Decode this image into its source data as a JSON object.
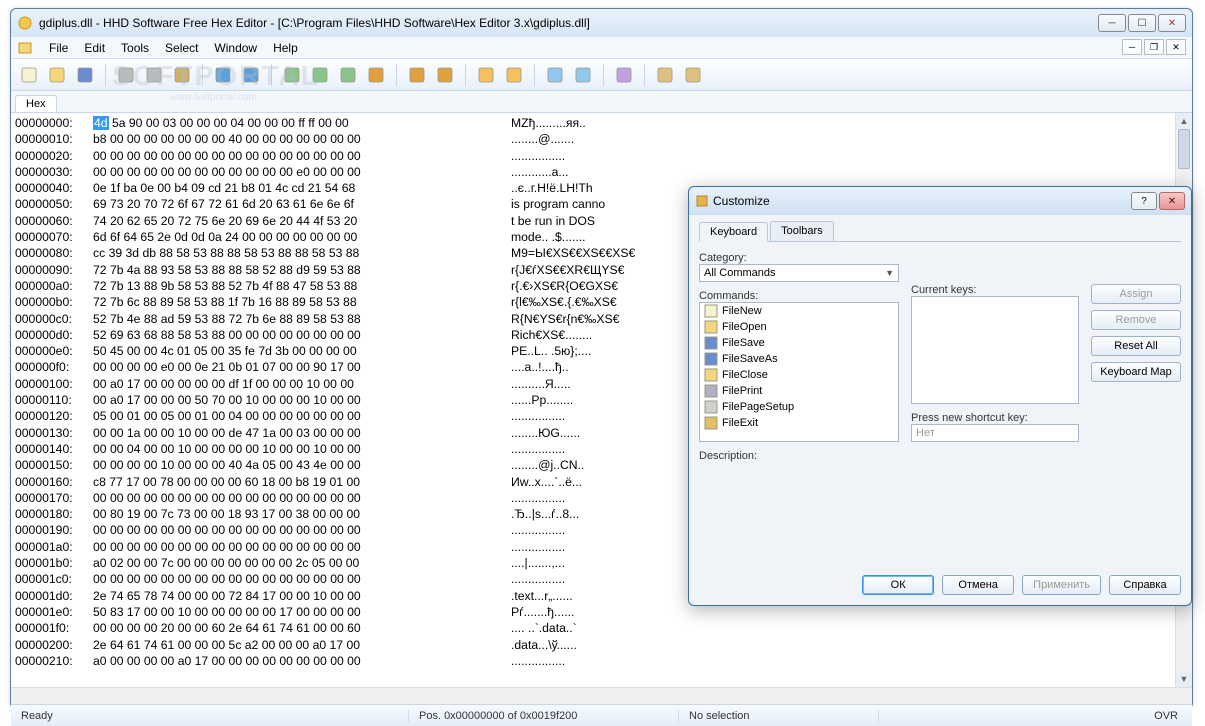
{
  "window": {
    "title": "gdiplus.dll - HHD Software Free Hex Editor - [C:\\Program Files\\HHD Software\\Hex Editor 3.x\\gdiplus.dll]"
  },
  "menus": [
    "File",
    "Edit",
    "Tools",
    "Select",
    "Window",
    "Help"
  ],
  "tab": {
    "label": "Hex"
  },
  "watermark": {
    "main": "SOFTPORTAL",
    "sub": "www.softportal.com"
  },
  "status": {
    "ready": "Ready",
    "pos": "Pos. 0x00000000 of 0x0019f200",
    "sel": "No selection",
    "mode": "OVR"
  },
  "hex_rows": [
    {
      "offset": "00000000:",
      "first": "4d",
      "bytes": " 5a 90 00 03 00 00 00 04 00 00 00 ff ff 00 00",
      "ascii": "MZђ.........яя.."
    },
    {
      "offset": "00000010:",
      "bytes": "b8 00 00 00 00 00 00 00 40 00 00 00 00 00 00 00",
      "ascii": "........@......."
    },
    {
      "offset": "00000020:",
      "bytes": "00 00 00 00 00 00 00 00 00 00 00 00 00 00 00 00",
      "ascii": "................"
    },
    {
      "offset": "00000030:",
      "bytes": "00 00 00 00 00 00 00 00 00 00 00 00 e0 00 00 00",
      "ascii": "............a..."
    },
    {
      "offset": "00000040:",
      "bytes": "0e 1f ba 0e 00 b4 09 cd 21 b8 01 4c cd 21 54 68",
      "ascii": "..є..г.Н!ё.LH!Th"
    },
    {
      "offset": "00000050:",
      "bytes": "69 73 20 70 72 6f 67 72 61 6d 20 63 61 6e 6e 6f",
      "ascii": "is program canno"
    },
    {
      "offset": "00000060:",
      "bytes": "74 20 62 65 20 72 75 6e 20 69 6e 20 44 4f 53 20",
      "ascii": "t be run in DOS "
    },
    {
      "offset": "00000070:",
      "bytes": "6d 6f 64 65 2e 0d 0d 0a 24 00 00 00 00 00 00 00",
      "ascii": "mode.. .$......."
    },
    {
      "offset": "00000080:",
      "bytes": "cc 39 3d db 88 58 53 88 88 58 53 88 88 58 53 88",
      "ascii": "M9=Ы€XS€€XS€€XS€"
    },
    {
      "offset": "00000090:",
      "bytes": "72 7b 4a 88 93 58 53 88 88 58 52 88 d9 59 53 88",
      "ascii": "r{J€ѓXS€€XR€ЩYS€"
    },
    {
      "offset": "000000a0:",
      "bytes": "72 7b 13 88 9b 58 53 88 52 7b 4f 88 47 58 53 88",
      "ascii": "r{.€›XS€R{O€GXS€"
    },
    {
      "offset": "000000b0:",
      "bytes": "72 7b 6c 88 89 58 53 88 1f 7b 16 88 89 58 53 88",
      "ascii": "r{l€‰XS€.{.€‰XS€"
    },
    {
      "offset": "000000c0:",
      "bytes": "52 7b 4e 88 ad 59 53 88 72 7b 6e 88 89 58 53 88",
      "ascii": "R{N€­YS€r{n€‰XS€"
    },
    {
      "offset": "000000d0:",
      "bytes": "52 69 63 68 88 58 53 88 00 00 00 00 00 00 00 00",
      "ascii": "Rich€XS€........"
    },
    {
      "offset": "000000e0:",
      "bytes": "50 45 00 00 4c 01 05 00 35 fe 7d 3b 00 00 00 00",
      "ascii": "PE..L.. .5ю};...."
    },
    {
      "offset": "000000f0:",
      "bytes": "00 00 00 00 e0 00 0e 21 0b 01 07 00 00 90 17 00",
      "ascii": "....a..!....ђ.."
    },
    {
      "offset": "00000100:",
      "bytes": "00 a0 17 00 00 00 00 00 df 1f 00 00 00 10 00 00",
      "ascii": "..........Я....."
    },
    {
      "offset": "00000110:",
      "bytes": "00 a0 17 00 00 00 50 70 00 10 00 00 00 10 00 00",
      "ascii": "......Pp........"
    },
    {
      "offset": "00000120:",
      "bytes": "05 00 01 00 05 00 01 00 04 00 00 00 00 00 00 00",
      "ascii": "................"
    },
    {
      "offset": "00000130:",
      "bytes": "00 00 1a 00 00 10 00 00 de 47 1a 00 03 00 00 00",
      "ascii": "........ЮG......"
    },
    {
      "offset": "00000140:",
      "bytes": "00 00 04 00 00 10 00 00 00 00 10 00 00 10 00 00",
      "ascii": "................"
    },
    {
      "offset": "00000150:",
      "bytes": "00 00 00 00 10 00 00 00 40 4a 05 00 43 4e 00 00",
      "ascii": "........@j..CN.."
    },
    {
      "offset": "00000160:",
      "bytes": "c8 77 17 00 78 00 00 00 00 60 18 00 b8 19 01 00",
      "ascii": "Иw..х....`..ё..."
    },
    {
      "offset": "00000170:",
      "bytes": "00 00 00 00 00 00 00 00 00 00 00 00 00 00 00 00",
      "ascii": "................"
    },
    {
      "offset": "00000180:",
      "bytes": "00 80 19 00 7c 73 00 00 18 93 17 00 38 00 00 00",
      "ascii": ".Ђ..|s...ѓ..8..."
    },
    {
      "offset": "00000190:",
      "bytes": "00 00 00 00 00 00 00 00 00 00 00 00 00 00 00 00",
      "ascii": "................"
    },
    {
      "offset": "000001a0:",
      "bytes": "00 00 00 00 00 00 00 00 00 00 00 00 00 00 00 00",
      "ascii": "................"
    },
    {
      "offset": "000001b0:",
      "bytes": "a0 02 00 00 7c 00 00 00 00 00 00 00 2c 05 00 00",
      "ascii": "....|.......,..."
    },
    {
      "offset": "000001c0:",
      "bytes": "00 00 00 00 00 00 00 00 00 00 00 00 00 00 00 00",
      "ascii": "................"
    },
    {
      "offset": "000001d0:",
      "bytes": "2e 74 65 78 74 00 00 00 72 84 17 00 00 10 00 00",
      "ascii": ".text...r„......"
    },
    {
      "offset": "000001e0:",
      "bytes": "50 83 17 00 00 10 00 00 00 00 00 17 00 00 00 00",
      "ascii": "Pѓ.......ђ......"
    },
    {
      "offset": "000001f0:",
      "bytes": "00 00 00 00 20 00 00 60 2e 64 61 74 61 00 00 60",
      "ascii": ".... ..`.data..`"
    },
    {
      "offset": "00000200:",
      "bytes": "2e 64 61 74 61 00 00 00 5c a2 00 00 00 a0 17 00",
      "ascii": ".data...\\ў......"
    },
    {
      "offset": "00000210:",
      "bytes": "a0 00 00 00 00 a0 17 00 00 00 00 00 00 00 00 00",
      "ascii": "................"
    }
  ],
  "dialog": {
    "title": "Customize",
    "tabs": [
      "Keyboard",
      "Toolbars"
    ],
    "category_label": "Category:",
    "category_value": "All Commands",
    "commands_label": "Commands:",
    "commands": [
      "FileNew",
      "FileOpen",
      "FileSave",
      "FileSaveAs",
      "FileClose",
      "FilePrint",
      "FilePageSetup",
      "FileExit"
    ],
    "currentkeys_label": "Current keys:",
    "press_label": "Press new shortcut key:",
    "press_value": "Нет",
    "desc_label": "Description:",
    "btn_assign": "Assign",
    "btn_remove": "Remove",
    "btn_reset": "Reset All",
    "btn_map": "Keyboard Map",
    "footer": {
      "ok": "ОК",
      "cancel": "Отмена",
      "apply": "Применить",
      "help": "Справка"
    }
  },
  "toolbar_icons": [
    "new",
    "open",
    "save",
    "sep",
    "cut",
    "copy",
    "paste",
    "sep",
    "undo",
    "redo",
    "sep",
    "find",
    "findnext",
    "replace",
    "goto",
    "sep",
    "bookmark-toggle",
    "bookmark-next",
    "sep",
    "checksum",
    "options",
    "sep",
    "sel-start",
    "sel-end",
    "sep",
    "fill",
    "sep",
    "view1",
    "view2"
  ]
}
